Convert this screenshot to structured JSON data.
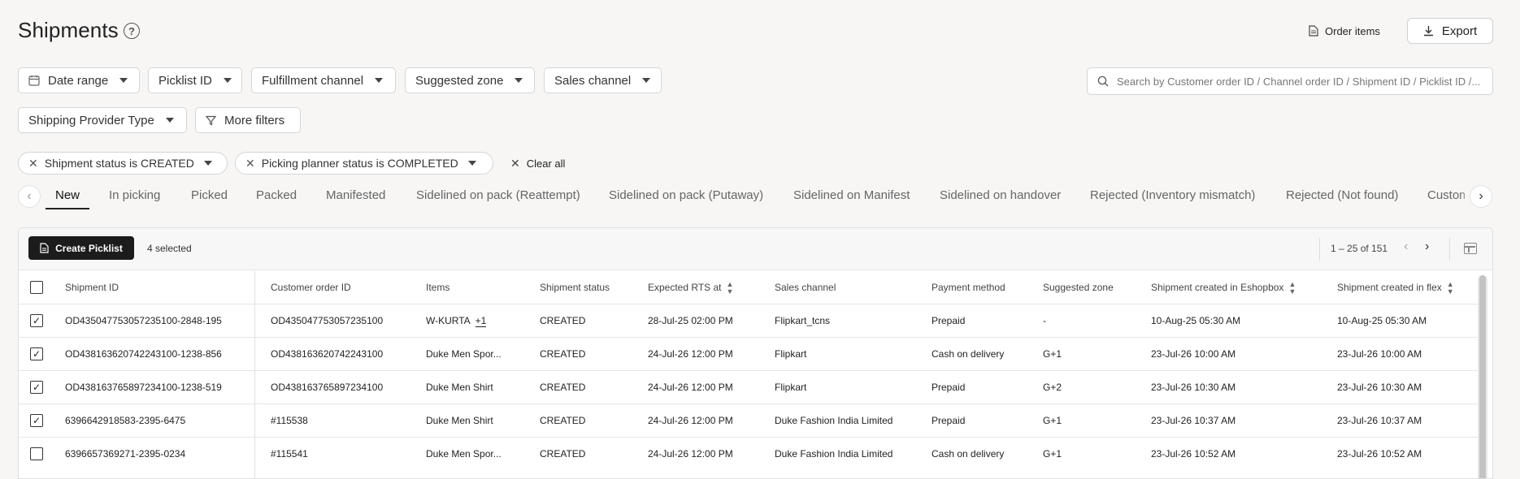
{
  "header": {
    "title": "Shipments",
    "help_icon": "?",
    "order_items_label": "Order items",
    "export_label": "Export"
  },
  "filters": [
    {
      "label": "Date range",
      "icon": "calendar-icon"
    },
    {
      "label": "Picklist ID"
    },
    {
      "label": "Fulfillment channel"
    },
    {
      "label": "Suggested zone"
    },
    {
      "label": "Sales channel"
    },
    {
      "label": "Shipping Provider Type"
    },
    {
      "label": "More filters",
      "icon": "funnel-icon"
    }
  ],
  "search": {
    "placeholder": "Search by Customer order ID / Channel order ID / Shipment ID / Picklist ID /..."
  },
  "active_filters": [
    {
      "label": "Shipment status is CREATED"
    },
    {
      "label": "Picking planner status is COMPLETED"
    }
  ],
  "clear_all_label": "Clear all",
  "tabs": [
    {
      "label": "New",
      "active": true
    },
    {
      "label": "In picking"
    },
    {
      "label": "Picked"
    },
    {
      "label": "Packed"
    },
    {
      "label": "Manifested"
    },
    {
      "label": "Sidelined on pack (Reattempt)"
    },
    {
      "label": "Sidelined on pack (Putaway)"
    },
    {
      "label": "Sidelined on Manifest"
    },
    {
      "label": "Sidelined on handover"
    },
    {
      "label": "Rejected (Inventory mismatch)"
    },
    {
      "label": "Rejected (Not found)"
    },
    {
      "label": "Custom"
    }
  ],
  "toolbar": {
    "create_picklist_label": "Create Picklist",
    "selected_label": "4 selected",
    "pagination": "1 – 25 of 151"
  },
  "table": {
    "columns": [
      "Shipment ID",
      "Customer order ID",
      "Items",
      "Shipment status",
      "Expected RTS at",
      "Sales channel",
      "Payment method",
      "Suggested zone",
      "Shipment created in Eshopbox",
      "Shipment created in flex"
    ],
    "rows": [
      {
        "checked": true,
        "shipment_id": "OD435047753057235100-2848-195",
        "customer_order_id": "OD435047753057235100",
        "items": "W-KURTA",
        "items_more": "+1",
        "status": "CREATED",
        "rts": "28-Jul-25 02:00 PM",
        "channel": "Flipkart_tcns",
        "payment": "Prepaid",
        "zone": "-",
        "created_eshopbox": "10-Aug-25 05:30 AM",
        "created_flex": "10-Aug-25 05:30 AM"
      },
      {
        "checked": true,
        "shipment_id": "OD438163620742243100-1238-856",
        "customer_order_id": "OD438163620742243100",
        "items": "Duke Men Spor...",
        "items_more": "",
        "status": "CREATED",
        "rts": "24-Jul-26 12:00 PM",
        "channel": "Flipkart",
        "payment": "Cash on delivery",
        "zone": "G+1",
        "created_eshopbox": "23-Jul-26 10:00 AM",
        "created_flex": "23-Jul-26 10:00 AM"
      },
      {
        "checked": true,
        "shipment_id": "OD438163765897234100-1238-519",
        "customer_order_id": "OD438163765897234100",
        "items": "Duke Men Shirt",
        "items_more": "",
        "status": "CREATED",
        "rts": "24-Jul-26 12:00 PM",
        "channel": "Flipkart",
        "payment": "Prepaid",
        "zone": "G+2",
        "created_eshopbox": "23-Jul-26 10:30 AM",
        "created_flex": "23-Jul-26 10:30 AM"
      },
      {
        "checked": true,
        "shipment_id": "6396642918583-2395-6475",
        "customer_order_id": "#115538",
        "items": "Duke Men Shirt",
        "items_more": "",
        "status": "CREATED",
        "rts": "24-Jul-26 12:00 PM",
        "channel": "Duke Fashion India Limited",
        "payment": "Prepaid",
        "zone": "G+1",
        "created_eshopbox": "23-Jul-26 10:37 AM",
        "created_flex": "23-Jul-26 10:37 AM"
      },
      {
        "checked": false,
        "shipment_id": "6396657369271-2395-0234",
        "customer_order_id": "#115541",
        "items": "Duke Men Spor...",
        "items_more": "",
        "status": "CREATED",
        "rts": "24-Jul-26 12:00 PM",
        "channel": "Duke Fashion India Limited",
        "payment": "Cash on delivery",
        "zone": "G+1",
        "created_eshopbox": "23-Jul-26 10:52 AM",
        "created_flex": "23-Jul-26 10:52 AM"
      }
    ]
  }
}
